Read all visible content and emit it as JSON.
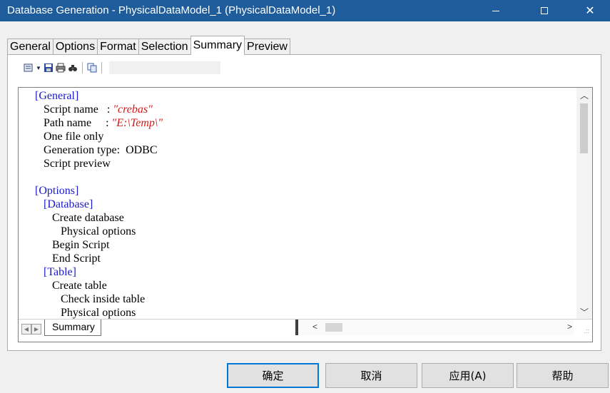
{
  "window": {
    "title": "Database Generation - PhysicalDataModel_1 (PhysicalDataModel_1)",
    "controls": [
      "minimize-icon",
      "maximize-icon",
      "close-icon"
    ],
    "titlebar_color": "#1f5c9c"
  },
  "tabs": [
    {
      "label": "General",
      "active": false
    },
    {
      "label": "Options",
      "active": false
    },
    {
      "label": "Format",
      "active": false
    },
    {
      "label": "Selection",
      "active": false
    },
    {
      "label": "Summary",
      "active": true
    },
    {
      "label": "Preview",
      "active": false
    }
  ],
  "toolbar": {
    "icons": [
      "report-view-icon",
      "dropdown-arrow-icon",
      "save-icon",
      "print-icon",
      "find-icon",
      "copy-icon"
    ]
  },
  "summary": {
    "lines": [
      {
        "indent": "",
        "text": "[General]",
        "style": "hdr"
      },
      {
        "indent": "   ",
        "text": "Script name   : ",
        "value": "\"crebas\""
      },
      {
        "indent": "   ",
        "text": "Path name     : ",
        "value": "\"E:\\Temp\\\""
      },
      {
        "indent": "   ",
        "text": "One file only"
      },
      {
        "indent": "   ",
        "text": "Generation type:  ODBC"
      },
      {
        "indent": "   ",
        "text": "Script preview"
      },
      {
        "indent": "",
        "text": ""
      },
      {
        "indent": "",
        "text": "[Options]",
        "style": "hdr"
      },
      {
        "indent": "   ",
        "text": "[Database]",
        "style": "hdr"
      },
      {
        "indent": "      ",
        "text": "Create database"
      },
      {
        "indent": "         ",
        "text": "Physical options"
      },
      {
        "indent": "      ",
        "text": "Begin Script"
      },
      {
        "indent": "      ",
        "text": "End Script"
      },
      {
        "indent": "   ",
        "text": "[Table]",
        "style": "hdr"
      },
      {
        "indent": "      ",
        "text": "Create table"
      },
      {
        "indent": "         ",
        "text": "Check inside table"
      },
      {
        "indent": "         ",
        "text": "Physical options"
      }
    ],
    "sheet_tab": "Summary",
    "header_color": "#1a1acc",
    "string_color": "#d51717"
  },
  "buttons": {
    "ok": "确定",
    "cancel": "取消",
    "apply": "应用(A)",
    "help": "帮助"
  }
}
